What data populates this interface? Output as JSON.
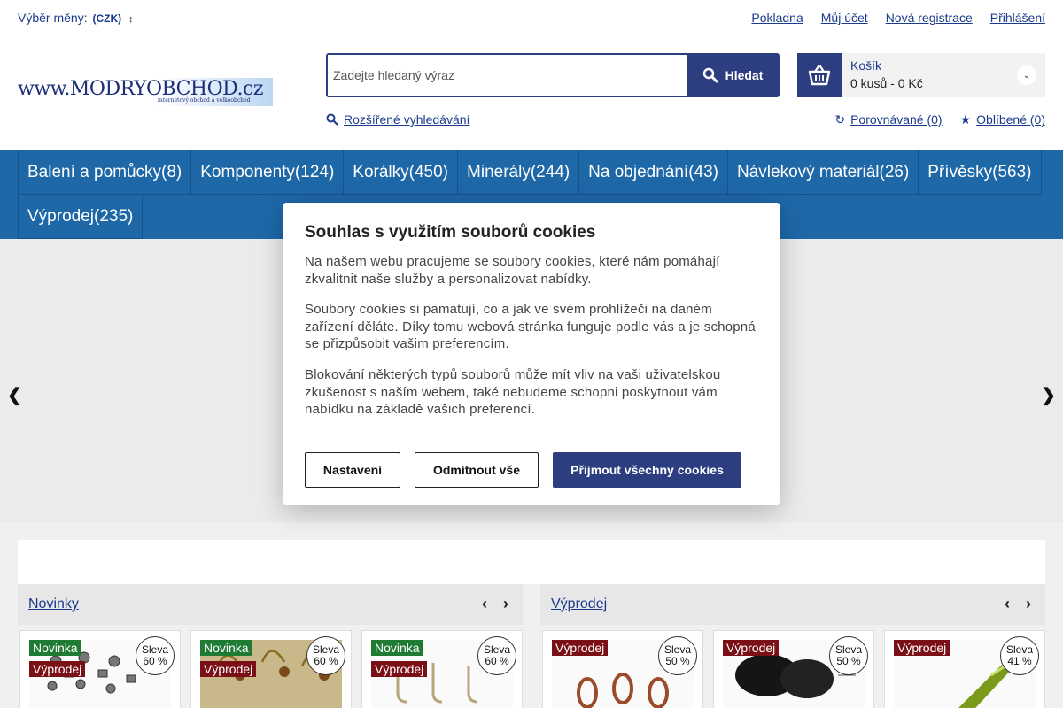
{
  "topbar": {
    "currency_label": "Výběr měny:",
    "currency_value": "(CZK)",
    "links": [
      "Pokladna",
      "Můj účet",
      "Nová registrace",
      "Přihlášení"
    ]
  },
  "header": {
    "logo_text": "www.MODRYOBCHOD.cz",
    "logo_subtext": "internetový obchod a velkoobchod",
    "search_placeholder": "Zadejte hledaný výraz",
    "search_button": "Hledat",
    "advanced_search": "Rozšířené vyhledávání",
    "cart_title": "Košík",
    "cart_value": "0 kusů - 0 Kč",
    "compare_link": "Porovnávané (0)",
    "favorites_link": "Oblíbené (0)"
  },
  "categories_row1": [
    "Balení a pomůcky(8)",
    "Komponenty(124)",
    "Korálky(450)",
    "Minerály(244)",
    "Na objednání(43)",
    "Návlekový materiál(26)",
    "Přívěsky(563)"
  ],
  "categories_row2": [
    "Výprodej(235)"
  ],
  "panels": {
    "left": {
      "title": "Novinky",
      "cards": [
        {
          "badges": [
            "Novinka",
            "Výprodej"
          ],
          "discount_label": "Sleva",
          "discount_value": "60 %"
        },
        {
          "badges": [
            "Novinka",
            "Výprodej"
          ],
          "discount_label": "Sleva",
          "discount_value": "60 %"
        },
        {
          "badges": [
            "Novinka",
            "Výprodej"
          ],
          "discount_label": "Sleva",
          "discount_value": "60 %"
        }
      ]
    },
    "right": {
      "title": "Výprodej",
      "cards": [
        {
          "badges": [
            "Výprodej"
          ],
          "discount_label": "Sleva",
          "discount_value": "50 %"
        },
        {
          "badges": [
            "Výprodej"
          ],
          "discount_label": "Sleva",
          "discount_value": "50 %"
        },
        {
          "badges": [
            "Výprodej"
          ],
          "discount_label": "Sleva",
          "discount_value": "41 %"
        }
      ]
    }
  },
  "cookie_modal": {
    "title": "Souhlas s využitím souborů cookies",
    "p1": "Na našem webu pracujeme se soubory cookies, které nám pomáhají zkvalitnit naše služby a personalizovat nabídky.",
    "p2": "Soubory cookies si pamatují, co a jak ve svém prohlížeči na daném zařízení děláte. Díky tomu webová stránka funguje podle vás a je schopná se přizpůsobit vašim preferencím.",
    "p3": "Blokování některých typů souborů může mít vliv na vaši uživatelskou zkušenost s naším webem, také nebudeme schopni poskytnout vám nabídku na základě vašich preferencí.",
    "btn_settings": "Nastavení",
    "btn_reject": "Odmítnout vše",
    "btn_accept": "Přijmout všechny cookies"
  },
  "colors": {
    "primary": "#2c3e80",
    "nav": "#1e68a8",
    "badge_new": "#1f7a34",
    "badge_sale": "#7a1016"
  }
}
